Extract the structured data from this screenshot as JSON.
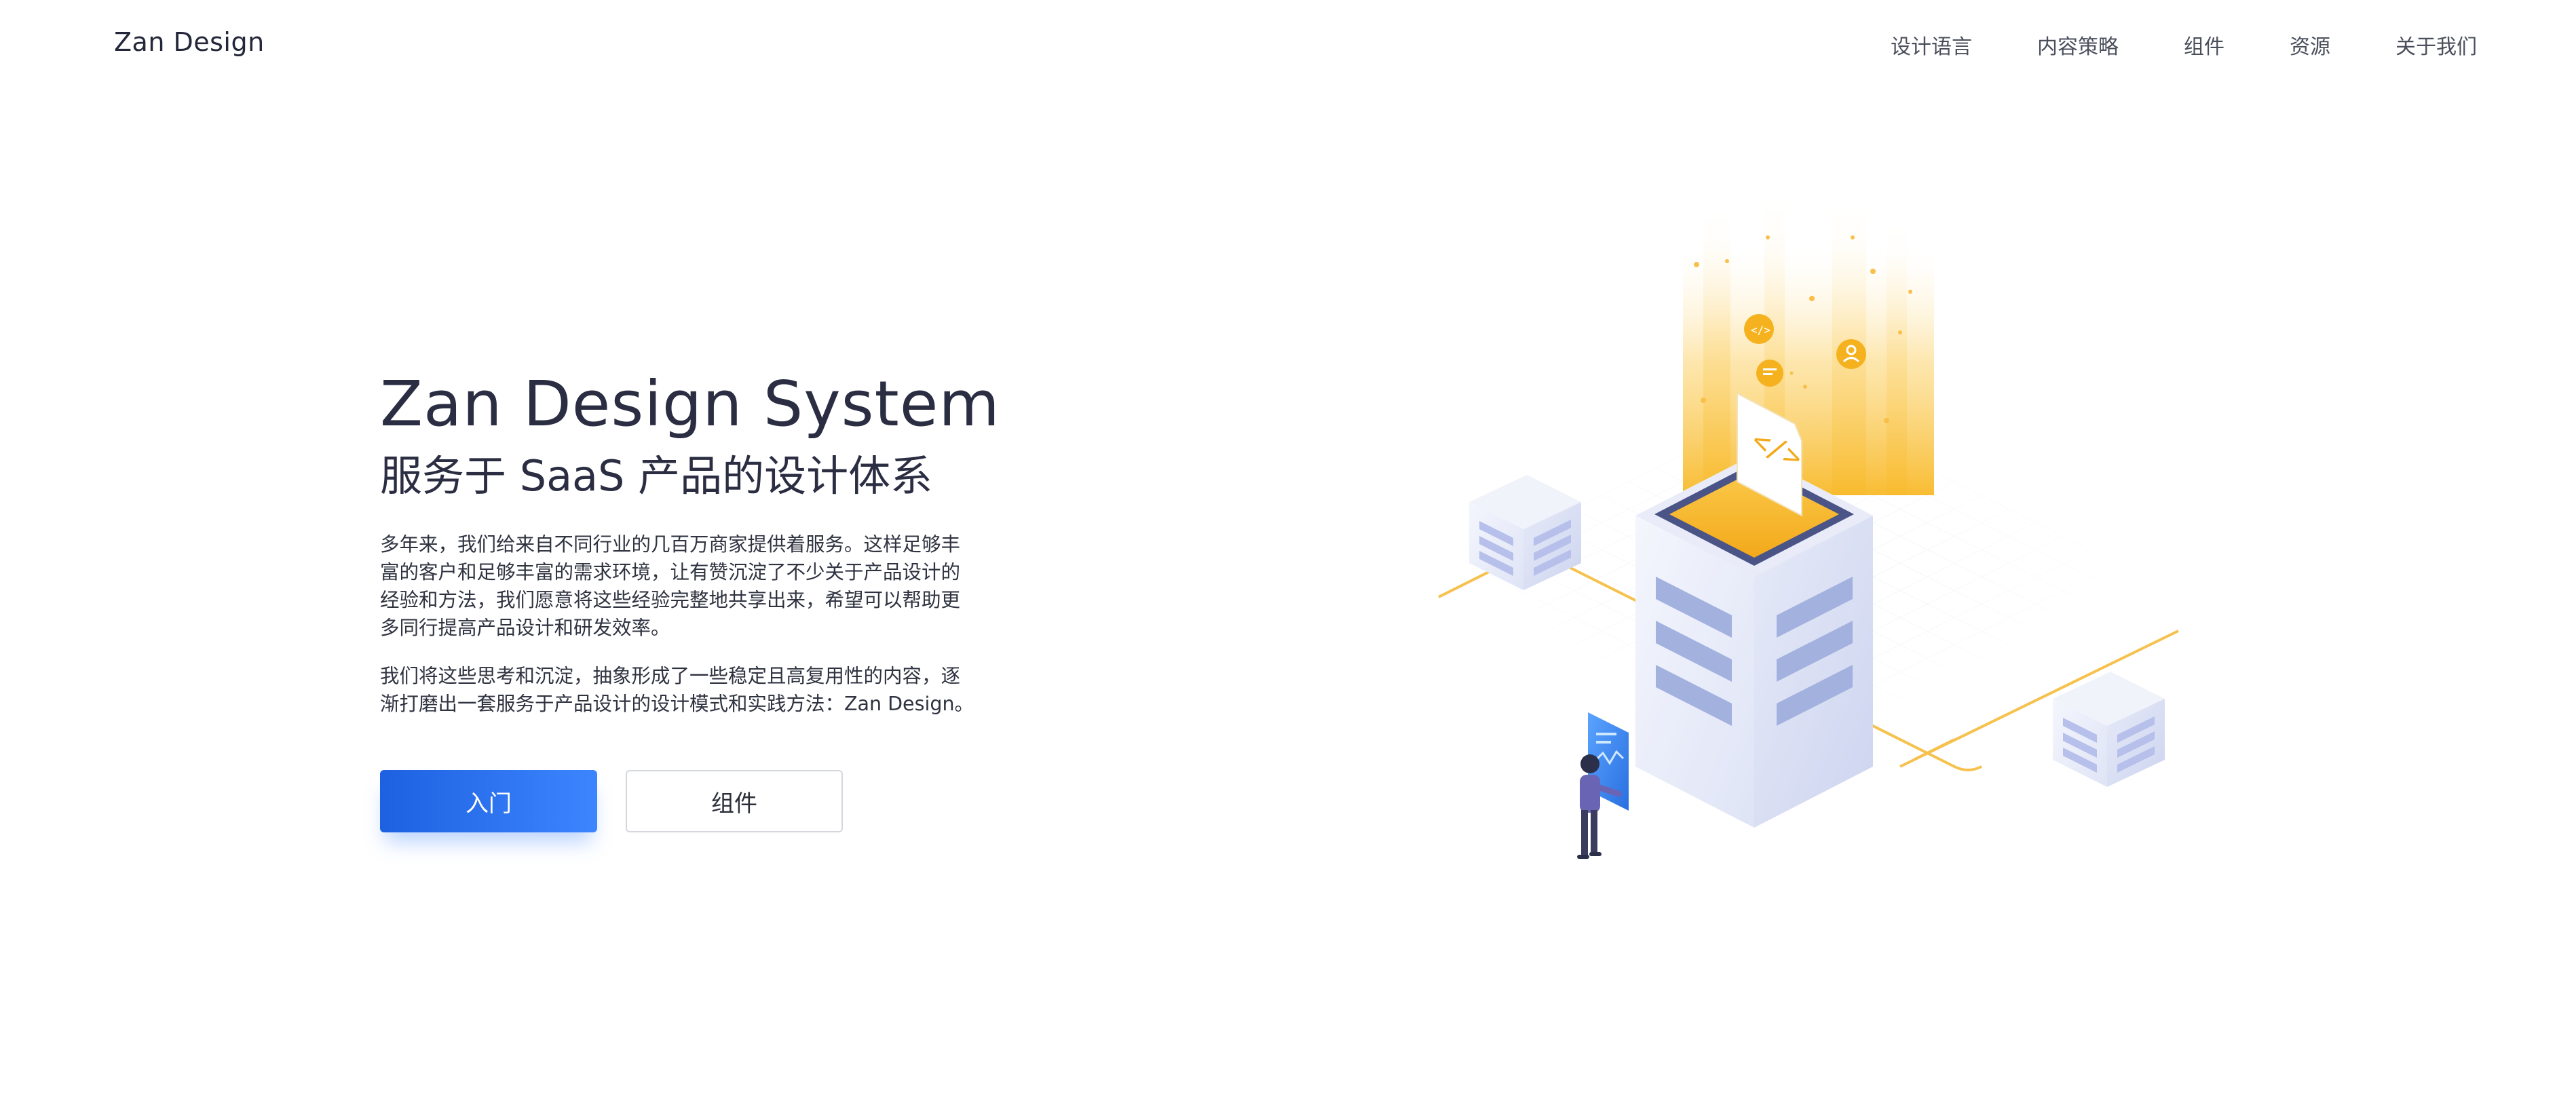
{
  "header": {
    "logo": "Zan Design",
    "nav": [
      {
        "label": "设计语言"
      },
      {
        "label": "内容策略"
      },
      {
        "label": "组件"
      },
      {
        "label": "资源"
      },
      {
        "label": "关于我们"
      }
    ]
  },
  "hero": {
    "title": "Zan Design System",
    "subtitle": "服务于 SaaS 产品的设计体系",
    "paragraph1": "多年来，我们给来自不同行业的几百万商家提供着服务。这样足够丰富的客户和足够丰富的需求环境，让有赞沉淀了不少关于产品设计的经验和方法，我们愿意将这些经验完整地共享出来，希望可以帮助更多同行提高产品设计和研发效率。",
    "paragraph2": "我们将这些思考和沉淀，抽象形成了一些稳定且高复用性的内容，逐渐打磨出一套服务于产品设计的设计模式和实践方法：Zan Design。",
    "primary_button": "入门",
    "secondary_button": "组件"
  },
  "colors": {
    "primary": "#2a6ff0",
    "accent": "#f5b82e",
    "text": "#2b2e42"
  },
  "illustration": {
    "icons": [
      "code-icon",
      "chat-icon",
      "user-icon",
      "document-code-icon"
    ]
  }
}
